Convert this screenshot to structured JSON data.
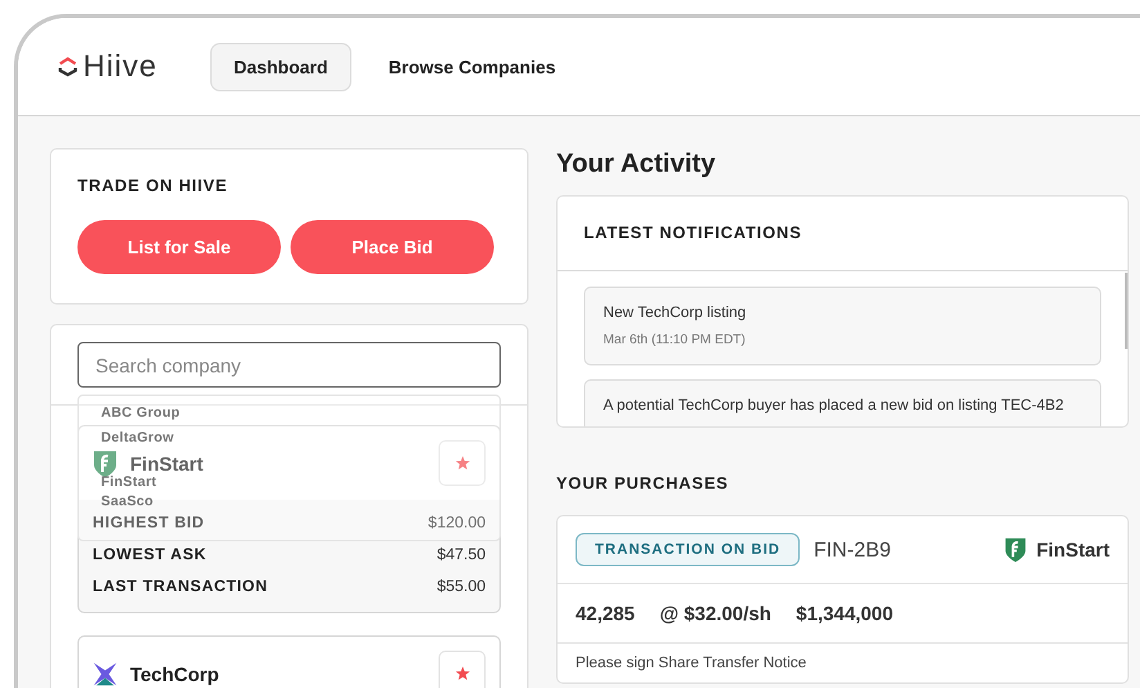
{
  "brand": {
    "name": "Hiive"
  },
  "nav": [
    {
      "label": "Dashboard",
      "selected": true
    },
    {
      "label": "Browse Companies",
      "selected": false
    }
  ],
  "trade": {
    "title": "TRADE ON HIIVE",
    "buttons": [
      "List for Sale",
      "Place Bid"
    ]
  },
  "search": {
    "placeholder": "Search company",
    "suggestions": [
      "ABC Group",
      "DeltaGrow",
      "FinStart",
      "SaaSco"
    ]
  },
  "companies": [
    {
      "name": "FinStart",
      "kind": "shield",
      "starred": true,
      "stats": [
        {
          "label": "HIGHEST BID",
          "value": "$120.00"
        },
        {
          "label": "LOWEST ASK",
          "value": "$47.50"
        },
        {
          "label": "LAST TRANSACTION",
          "value": "$55.00"
        }
      ]
    },
    {
      "name": "TechCorp",
      "kind": "cross",
      "starred": true
    }
  ],
  "activity": {
    "title": "Your Activity",
    "notifications_title": "LATEST NOTIFICATIONS",
    "notifications": [
      {
        "text": "New TechCorp listing",
        "time": "Mar 6th (11:10 PM EDT)"
      },
      {
        "text": "A potential TechCorp buyer has placed a new bid on listing TEC-4B2"
      }
    ]
  },
  "purchases": {
    "title": "YOUR PURCHASES",
    "items": [
      {
        "tag": "TRANSACTION ON BID",
        "id": "FIN-2B9",
        "company": "FinStart",
        "kind": "shield",
        "shares": "42,285",
        "price": "@ $32.00/sh",
        "total": "$1,344,000",
        "note": "Please sign Share Transfer Notice"
      }
    ]
  }
}
